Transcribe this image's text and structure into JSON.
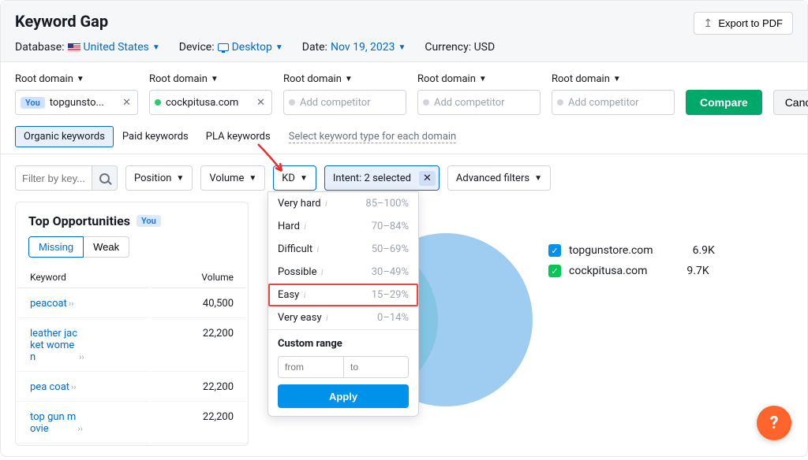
{
  "header": {
    "title": "Keyword Gap",
    "export_label": "Export to PDF",
    "database_label": "Database:",
    "database_value": "United States",
    "device_label": "Device:",
    "device_value": "Desktop",
    "date_label": "Date:",
    "date_value": "Nov 19, 2023",
    "currency_label": "Currency: USD"
  },
  "domains": {
    "root_label": "Root domain",
    "you_tag": "You",
    "items": [
      {
        "text": "topgunsto...",
        "you": true
      },
      {
        "text": "cockpitusa.com",
        "dot": true
      }
    ],
    "placeholder": "Add competitor",
    "compare": "Compare",
    "cancel": "Cancel"
  },
  "kw_types": {
    "tabs": [
      "Organic keywords",
      "Paid keywords",
      "PLA keywords"
    ],
    "per_domain": "Select keyword type for each domain"
  },
  "filters": {
    "input_placeholder": "Filter by key...",
    "position": "Position",
    "volume": "Volume",
    "kd": "KD",
    "intent": "Intent: 2 selected",
    "advanced": "Advanced filters"
  },
  "kd_menu": {
    "rows": [
      {
        "label": "Very hard",
        "range": "85–100%"
      },
      {
        "label": "Hard",
        "range": "70–84%"
      },
      {
        "label": "Difficult",
        "range": "50–69%"
      },
      {
        "label": "Possible",
        "range": "30–49%"
      },
      {
        "label": "Easy",
        "range": "15–29%",
        "highlight": true
      },
      {
        "label": "Very easy",
        "range": "0–14%"
      }
    ],
    "custom_title": "Custom range",
    "from_ph": "from",
    "to_ph": "to",
    "apply": "Apply"
  },
  "opportunities": {
    "title": "Top Opportunities",
    "you": "You",
    "seg": [
      "Missing",
      "Weak"
    ],
    "cols": [
      "Keyword",
      "Volume"
    ],
    "rows": [
      {
        "kw": "peacoat",
        "vol": "40,500"
      },
      {
        "kw": "leather jacket women",
        "vol": "22,200"
      },
      {
        "kw": "pea coat",
        "vol": "22,200"
      },
      {
        "kw": "top gun movie",
        "vol": "22,200"
      }
    ]
  },
  "legend": [
    {
      "color": "blue",
      "name": "topgunstore.com",
      "val": "6.9K"
    },
    {
      "color": "green",
      "name": "cockpitusa.com",
      "val": "9.7K"
    }
  ],
  "help": "?"
}
